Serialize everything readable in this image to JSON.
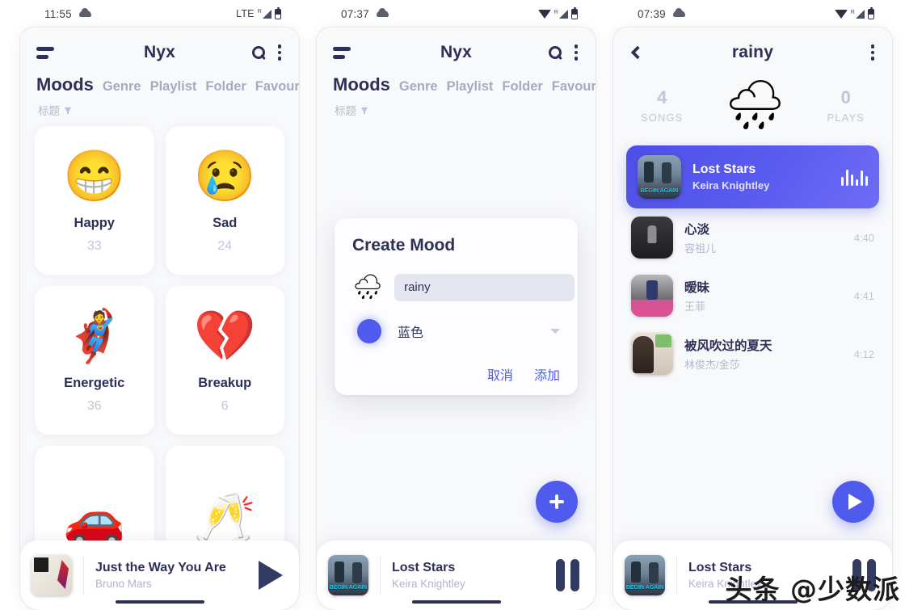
{
  "watermark": "头条 @少数派",
  "colors": {
    "accent": "#4f5bec",
    "dark_navy": "#2c3055",
    "muted": "#b6bac9",
    "screen_bg": "#f8f9fb"
  },
  "phone1": {
    "statusbar": {
      "time": "11:55",
      "network": "LTE",
      "weather_icon": "cloud-icon",
      "signal_icon": "signal-icon",
      "battery_icon": "battery-icon"
    },
    "appbar": {
      "menu_icon": "hamburger-icon",
      "title": "Nyx",
      "search_icon": "search-icon",
      "overflow_icon": "kebab-menu-icon"
    },
    "tabs": [
      {
        "label": "Moods",
        "active": true
      },
      {
        "label": "Genre",
        "active": false
      },
      {
        "label": "Playlist",
        "active": false
      },
      {
        "label": "Folder",
        "active": false
      },
      {
        "label": "Favourite",
        "active": false
      }
    ],
    "sort": {
      "label": "标题",
      "icon": "sort-descending-icon"
    },
    "moods": [
      {
        "emoji": "😁",
        "name": "Happy",
        "count": "33"
      },
      {
        "emoji": "😢",
        "name": "Sad",
        "count": "24"
      },
      {
        "emoji": "🦸",
        "name": "Energetic",
        "count": "36"
      },
      {
        "emoji": "💔",
        "name": "Breakup",
        "count": "6"
      },
      {
        "emoji": "🚗",
        "name": "",
        "count": ""
      },
      {
        "emoji": "🥂",
        "name": "",
        "count": ""
      }
    ],
    "player": {
      "title": "Just the Way You Are",
      "artist": "Bruno Mars",
      "control_icon": "play-icon"
    }
  },
  "phone2": {
    "statusbar": {
      "time": "07:37",
      "network": "",
      "weather_icon": "cloud-icon",
      "signal_icon": "signal-icon",
      "battery_icon": "battery-icon"
    },
    "appbar": {
      "menu_icon": "hamburger-icon",
      "title": "Nyx",
      "search_icon": "search-icon",
      "overflow_icon": "kebab-menu-icon"
    },
    "tabs": [
      {
        "label": "Moods",
        "active": true
      },
      {
        "label": "Genre",
        "active": false
      },
      {
        "label": "Playlist",
        "active": false
      },
      {
        "label": "Folder",
        "active": false
      },
      {
        "label": "Favourite",
        "active": false
      }
    ],
    "sort": {
      "label": "标题",
      "icon": "sort-descending-icon"
    },
    "dialog": {
      "title": "Create Mood",
      "emoji": "🌧",
      "name_value": "rainy",
      "name_placeholder": "",
      "color_swatch": "#4f5bec",
      "color_label": "蓝色",
      "dropdown_icon": "chevron-down-icon",
      "cancel_label": "取消",
      "confirm_label": "添加"
    },
    "fab": {
      "icon": "plus-icon"
    },
    "player": {
      "title": "Lost Stars",
      "artist": "Keira Knightley",
      "control_icon": "pause-icon"
    }
  },
  "phone3": {
    "statusbar": {
      "time": "07:39",
      "network": "",
      "weather_icon": "cloud-icon",
      "signal_icon": "signal-icon",
      "battery_icon": "battery-icon"
    },
    "appbar": {
      "back_icon": "back-chevron-icon",
      "title": "rainy",
      "overflow_icon": "kebab-menu-icon"
    },
    "header": {
      "songs_count": "4",
      "songs_label": "SONGS",
      "emoji": "🌧",
      "plays_count": "0",
      "plays_label": "PLAYS"
    },
    "songs": [
      {
        "title": "Lost Stars",
        "artist": "Keira Knightley",
        "duration": "",
        "active": true,
        "art": "art-beginagain",
        "indicator_icon": "equalizer-icon"
      },
      {
        "title": "心淡",
        "artist": "容祖儿",
        "duration": "4:40",
        "active": false,
        "art": "art-dark"
      },
      {
        "title": "暧昧",
        "artist": "王菲",
        "duration": "4:41",
        "active": false,
        "art": "art-pink"
      },
      {
        "title": "被风吹过的夏天",
        "artist": "林俊杰/金莎",
        "duration": "4:12",
        "active": false,
        "art": "art-girl"
      }
    ],
    "fab": {
      "icon": "play-icon"
    },
    "player": {
      "title": "Lost Stars",
      "artist": "Keira Knightley",
      "control_icon": "pause-icon"
    }
  }
}
